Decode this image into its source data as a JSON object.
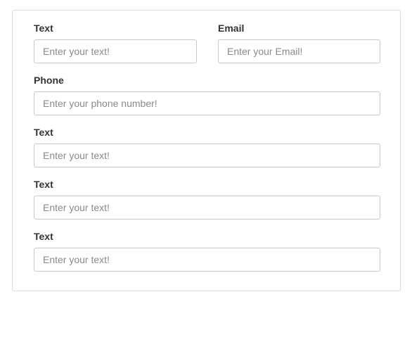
{
  "form": {
    "fields": [
      {
        "label": "Text",
        "placeholder": "Enter your text!",
        "value": ""
      },
      {
        "label": "Email",
        "placeholder": "Enter your Email!",
        "value": ""
      },
      {
        "label": "Phone",
        "placeholder": "Enter your phone number!",
        "value": ""
      },
      {
        "label": "Text",
        "placeholder": "Enter your text!",
        "value": ""
      },
      {
        "label": "Text",
        "placeholder": "Enter your text!",
        "value": ""
      },
      {
        "label": "Text",
        "placeholder": "Enter your text!",
        "value": ""
      }
    ]
  },
  "colors": {
    "border": "#dcdcdc",
    "input_border": "#c8c8c8",
    "label": "#333333",
    "placeholder": "#8a8a8a"
  }
}
